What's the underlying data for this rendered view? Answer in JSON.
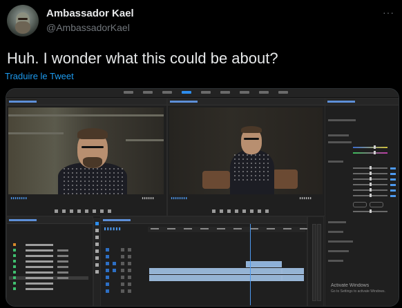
{
  "tweet": {
    "display_name": "Ambassador Kael",
    "handle": "@AmbassadorKael",
    "more_menu": "···",
    "text": "Huh. I wonder what this could be about?",
    "translate_link": "Traduire le Tweet"
  },
  "media": {
    "app": "video editor",
    "windows_watermark": {
      "title": "Activate Windows",
      "subtitle": "Go to Settings to activate Windows."
    }
  },
  "icons": {
    "more": "more-horizontal-icon"
  },
  "colors": {
    "background": "#000000",
    "text": "#e7e9ea",
    "secondary_text": "#71767b",
    "link": "#1d9bf0",
    "accent": "#2d8ceb"
  }
}
